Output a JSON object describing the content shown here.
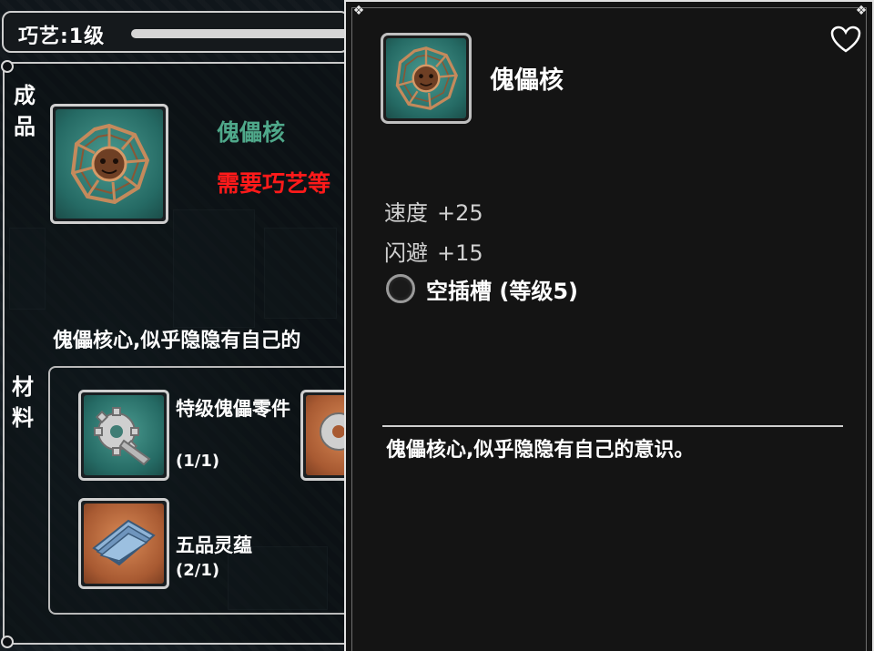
{
  "left_panel": {
    "skill_label": "巧艺:1级",
    "product_section_label": "成品",
    "materials_section_label": "材料",
    "product": {
      "icon": "puppet-core-icon",
      "name": "傀儡核",
      "requirement_text": "需要巧艺等",
      "description": "傀儡核心,似乎隐隐有自己的"
    },
    "materials": [
      {
        "icon": "gear-screw-icon",
        "name": "特级傀儡零件",
        "count": "(1/1)"
      },
      {
        "icon": "folded-cloth-icon",
        "name": "五品灵蕴",
        "count": "(2/1)"
      }
    ],
    "colors": {
      "product_name": "#4fa88a",
      "requirement": "#ff1a1a"
    }
  },
  "tooltip": {
    "title": "傀儡核",
    "icon": "puppet-core-icon",
    "favorite_icon": "heart-icon",
    "stats": [
      {
        "name": "速度",
        "value": "+25"
      },
      {
        "name": "闪避",
        "value": "+15"
      }
    ],
    "socket": {
      "icon": "empty-socket-icon",
      "text": "空插槽 (等级5)"
    },
    "description": "傀儡核心,似乎隐隐有自己的意识。"
  }
}
